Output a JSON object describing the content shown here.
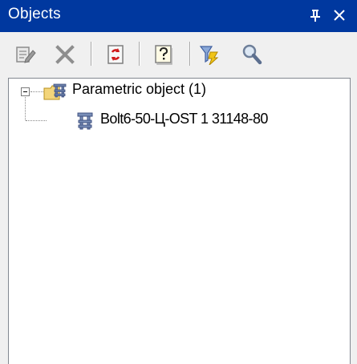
{
  "panel": {
    "title": "Objects",
    "pin_symbol": "\u0002",
    "close_symbol": "✕",
    "colors": {
      "titlebar_bg": "#00389f",
      "titlebar_text": "#ffffff",
      "panel_bg": "#f0f0f0",
      "tree_bg": "#ffffff"
    }
  },
  "toolbar": {
    "buttons": [
      {
        "icon": "edit-properties-icon"
      },
      {
        "icon": "delete-icon"
      },
      {
        "icon": "refresh-icon"
      },
      {
        "icon": "help-icon"
      },
      {
        "icon": "filter-icon"
      },
      {
        "icon": "search-icon"
      }
    ]
  },
  "tree": {
    "root": {
      "label": "Parametric object (1)",
      "icon": "parametric-folder-icon",
      "expanded": true,
      "children": [
        {
          "label": "Bolt6-50-Ц-OST 1 31148-80",
          "icon": "bolt-icon"
        }
      ]
    }
  }
}
